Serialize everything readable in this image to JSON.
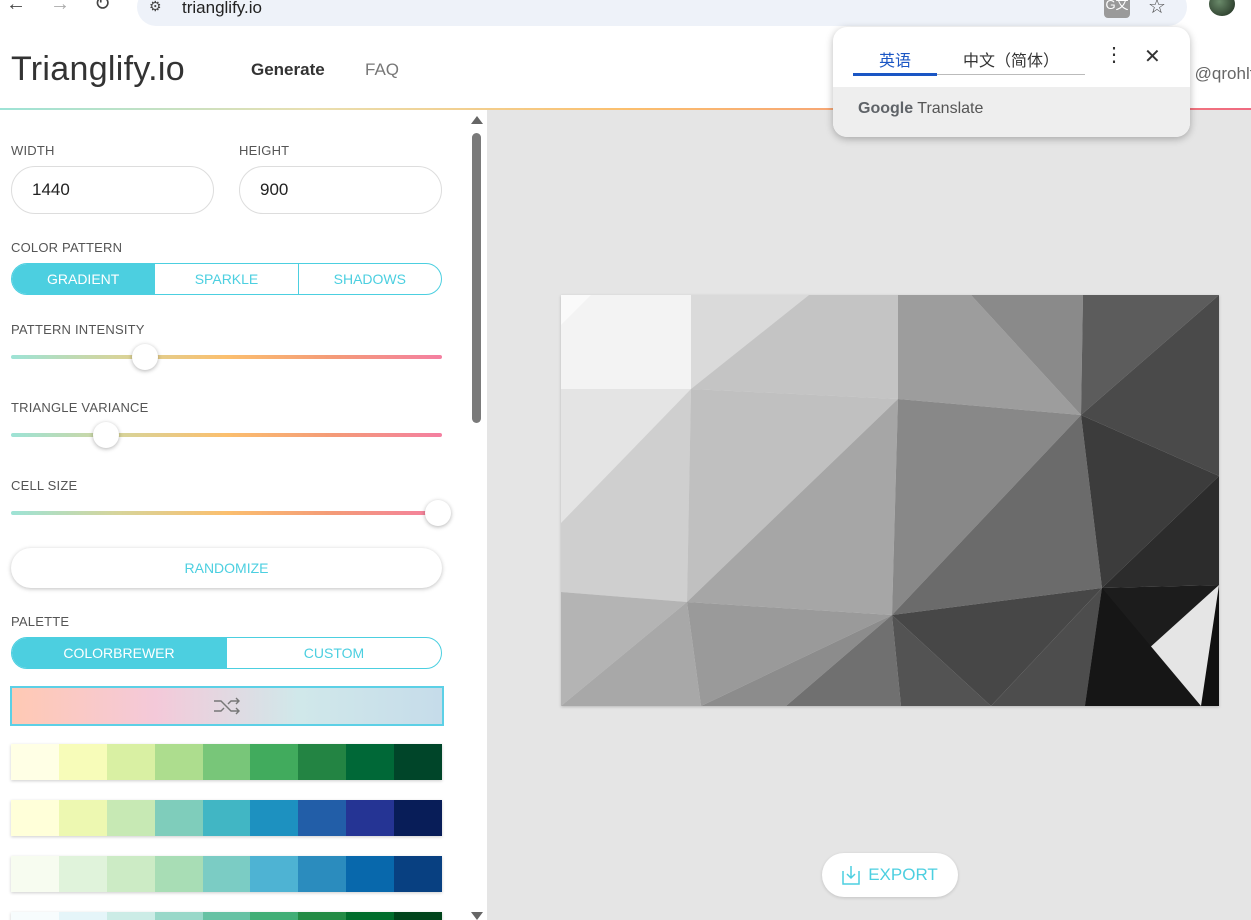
{
  "browser": {
    "url": "trianglify.io",
    "translate_icon_label": "G文"
  },
  "header": {
    "brand": "Trianglify.io",
    "nav_generate": "Generate",
    "nav_faq": "FAQ",
    "byline": "by @qrohlf"
  },
  "sidebar": {
    "width_label": "WIDTH",
    "width_value": "1440",
    "height_label": "HEIGHT",
    "height_value": "900",
    "color_pattern_label": "COLOR PATTERN",
    "color_pattern_options": [
      "GRADIENT",
      "SPARKLE",
      "SHADOWS"
    ],
    "color_pattern_selected": "GRADIENT",
    "pattern_intensity_label": "PATTERN INTENSITY",
    "pattern_intensity_value": 0.31,
    "triangle_variance_label": "TRIANGLE VARIANCE",
    "triangle_variance_value": 0.22,
    "cell_size_label": "CELL SIZE",
    "cell_size_value": 0.99,
    "randomize_label": "RANDOMIZE",
    "palette_label": "PALETTE",
    "palette_options": [
      "COLORBREWER",
      "CUSTOM"
    ],
    "palette_selected": "COLORBREWER",
    "shuffle_icon": "shuffle-icon",
    "palettes": [
      [
        "#ffffe5",
        "#f7fcb9",
        "#d9f0a3",
        "#addd8e",
        "#78c679",
        "#41ab5d",
        "#238443",
        "#006837",
        "#004529"
      ],
      [
        "#ffffd9",
        "#edf8b1",
        "#c7e9b4",
        "#7fcdbb",
        "#41b6c4",
        "#1d91c0",
        "#225ea8",
        "#253494",
        "#081d58"
      ],
      [
        "#f7fcf0",
        "#e0f3db",
        "#ccebc5",
        "#a8ddb5",
        "#7bccc4",
        "#4eb3d3",
        "#2b8cbe",
        "#0868ac",
        "#084081"
      ],
      [
        "#f7fcfd",
        "#e5f5f9",
        "#ccece6",
        "#99d8c9",
        "#66c2a4",
        "#41ae76",
        "#238b45",
        "#006d2c",
        "#00441b"
      ]
    ]
  },
  "main": {
    "export_label": "EXPORT",
    "export_icon": "download-icon"
  },
  "translate_popup": {
    "tab_source": "英语",
    "tab_target": "中文（简体）",
    "brand_google": "Google",
    "brand_translate": "Translate"
  },
  "colors": {
    "accent": "#4ccfe0"
  }
}
